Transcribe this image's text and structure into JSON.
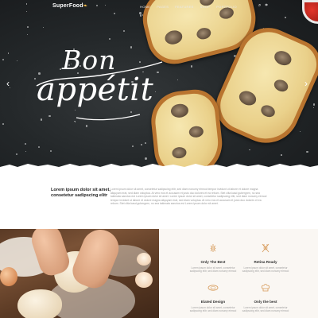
{
  "brand": {
    "name": "SuperFood",
    "mark": "❧"
  },
  "nav": {
    "items": [
      "Home",
      "Pages",
      "Features",
      "Shop",
      "Portfolio"
    ],
    "search_icon": "search-icon",
    "cart_icon": "cart-icon"
  },
  "hero": {
    "line1": "Bon",
    "line2": "appétit",
    "prev": "‹",
    "next": "›"
  },
  "intro": {
    "heading": "Lorem ipsum dolor sit amet, consetetur sadipscing elitr",
    "body": "Lorem ipsum dolor sit amet, consetetur sadipscing elitr, sed diam nonumy eirmod tempor invidunt ut labore et dolore magna aliquyam erat, sed diam voluptua. At vero eos et accusam et justo duo dolores et ea rebum. Stet clita kasd gubergren, no sea takimata sanctus est Lorem ipsum dolor sit amet. Lorem ipsum dolor sit amet, consetetur sadipscing elitr, sed diam nonumy eirmod tempor invidunt ut labore et dolore magna aliquyam erat, sed diam voluptua. At vero eos et accusam et justo duo dolores et ea rebum. Stet clita kasd gubergren, no sea takimata sanctus est Lorem ipsum dolor sit amet."
  },
  "features": [
    {
      "title": "Only The Best",
      "text": "Lorem ipsum dolor sit amet, consetetur sadipscing elitr, sed diam nonumy eirmod",
      "icon": "wheat-icon"
    },
    {
      "title": "Retina Ready",
      "text": "Lorem ipsum dolor sit amet, consetetur sadipscing elitr, sed diam nonumy eirmod",
      "icon": "crossed-utensils-icon"
    },
    {
      "title": "Elated Design",
      "text": "Lorem ipsum dolor sit amet, consetetur sadipscing elitr, sed diam nonumy eirmod",
      "icon": "dish-icon"
    },
    {
      "title": "Only the best",
      "text": "Lorem ipsum dolor sit amet, consetetur sadipscing elitr, sed diam nonumy eirmod",
      "icon": "chef-hat-icon"
    }
  ],
  "colors": {
    "accent": "#d79b5a",
    "hero_bg": "#24282a",
    "features_bg": "#faf7f3"
  }
}
